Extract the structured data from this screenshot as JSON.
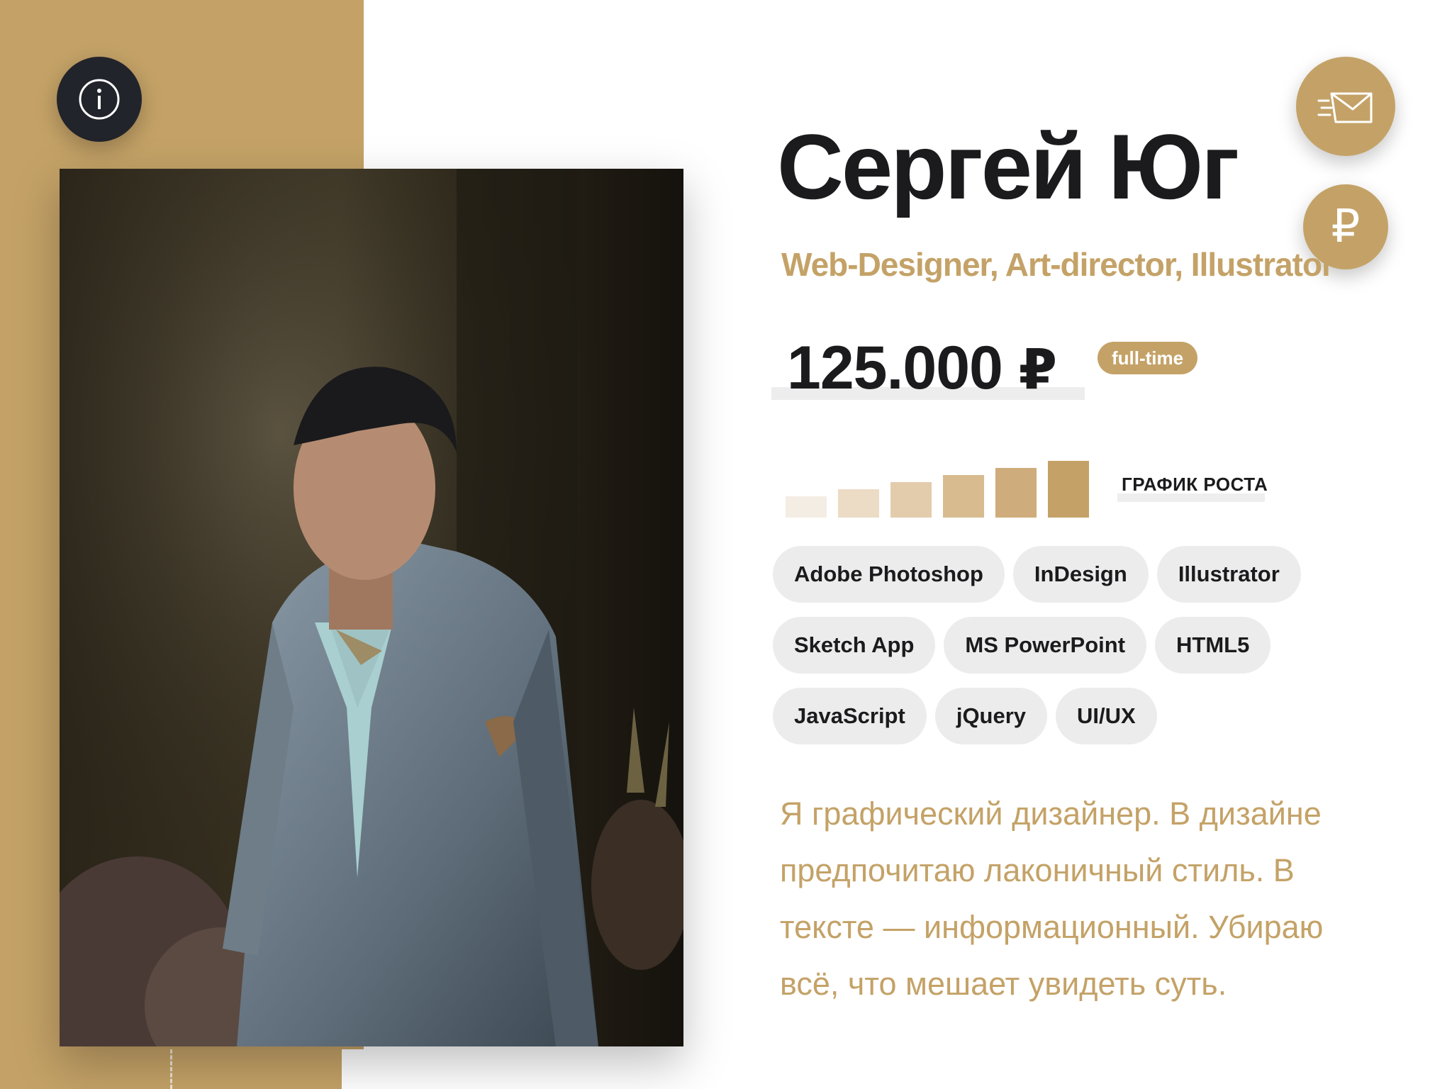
{
  "profile": {
    "name": "Сергей Юг",
    "role": "Web-Designer, Art-director, Illustrator",
    "salary": "125.000",
    "currency": "₽",
    "employment_badge": "full-time"
  },
  "actions": {
    "info_icon": "info-icon",
    "mail_icon": "mail-icon",
    "ruble_symbol": "₽"
  },
  "growth": {
    "label": "ГРАФИК РОСТА",
    "values": [
      1,
      2,
      3,
      4,
      5,
      6
    ],
    "colors": [
      "#f4ede3",
      "#ecdcc6",
      "#e3ccab",
      "#d9bb90",
      "#cfac7b",
      "#c4a267"
    ]
  },
  "skills": [
    [
      "Adobe Photoshop",
      "InDesign",
      "Illustrator"
    ],
    [
      "Sketch App",
      "MS PowerPoint",
      "HTML5"
    ],
    [
      "JavaScript",
      "jQuery",
      "UI/UX"
    ]
  ],
  "bio": "Я графический дизайнер. В дизайне предпочитаю лаконичный стиль. В тексте — информационный. Убираю всё, что мешает увидеть суть.",
  "colors": {
    "accent": "#c4a267",
    "dark": "#22242b",
    "text": "#1b1b1d",
    "chip": "#ececec"
  }
}
